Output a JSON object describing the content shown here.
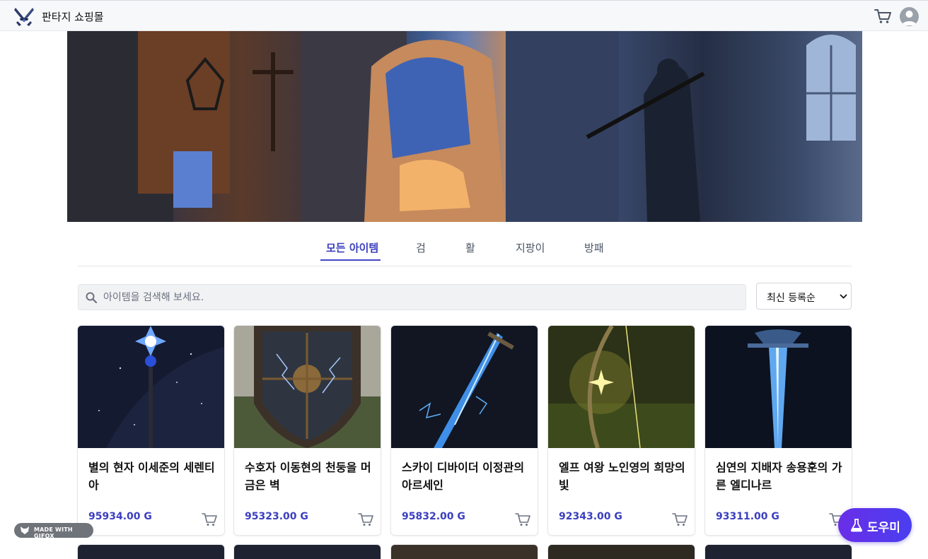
{
  "header": {
    "brand": "판타지 쇼핑몰",
    "logo_icon": "crossed-swords-icon",
    "cart_icon": "cart-icon",
    "avatar_icon": "user-avatar-icon"
  },
  "tabs": [
    {
      "label": "모든 아이템",
      "active": true
    },
    {
      "label": "검",
      "active": false
    },
    {
      "label": "활",
      "active": false
    },
    {
      "label": "지팡이",
      "active": false
    },
    {
      "label": "방패",
      "active": false
    }
  ],
  "search": {
    "placeholder": "아이템을 검색해 보세요.",
    "value": ""
  },
  "sort": {
    "selected": "최신 등록순"
  },
  "products": [
    {
      "title": "별의 현자 이세준의 세렌티아",
      "price": "95934.00 G",
      "image": "staff-star"
    },
    {
      "title": "수호자 이동현의 천둥을 머금은 벽",
      "price": "95323.00 G",
      "image": "shield-lightning"
    },
    {
      "title": "스카이 디바이더 이정관의 아르세인",
      "price": "95832.00 G",
      "image": "sword-lightning"
    },
    {
      "title": "엘프 여왕 노인영의 희망의 빛",
      "price": "92343.00 G",
      "image": "bow-light"
    },
    {
      "title": "심연의 지배자 송용훈의 가른 엘디나르",
      "price": "93311.00 G",
      "image": "sword-ice"
    }
  ],
  "floating": {
    "gifox_label": "MADE WITH GIFOX",
    "helper_label": "도우미",
    "helper_icon": "flask-icon"
  },
  "colors": {
    "accent": "#3b3fbf",
    "helper": "#5a35ec"
  }
}
